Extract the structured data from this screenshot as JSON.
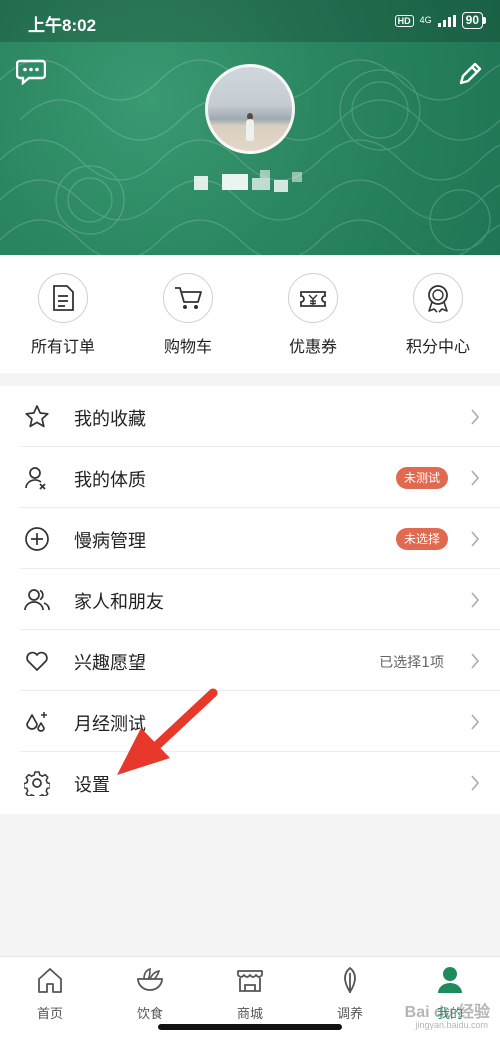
{
  "status": {
    "time": "上午8:02",
    "hd": "HD",
    "network": "4G",
    "battery": "90"
  },
  "quick_actions": [
    {
      "label": "所有订单",
      "icon": "order-list-icon"
    },
    {
      "label": "购物车",
      "icon": "shopping-cart-icon"
    },
    {
      "label": "优惠券",
      "icon": "coupon-icon"
    },
    {
      "label": "积分中心",
      "icon": "award-badge-icon"
    }
  ],
  "menu": [
    {
      "label": "我的收藏",
      "icon": "star-icon"
    },
    {
      "label": "我的体质",
      "icon": "person-check-icon",
      "badge": "未测试"
    },
    {
      "label": "慢病管理",
      "icon": "plus-circle-icon",
      "badge": "未选择"
    },
    {
      "label": "家人和朋友",
      "icon": "people-icon"
    },
    {
      "label": "兴趣愿望",
      "icon": "heart-icon",
      "value": "已选择1项"
    },
    {
      "label": "月经测试",
      "icon": "drops-icon"
    },
    {
      "label": "设置",
      "icon": "gear-icon"
    }
  ],
  "tabs": [
    {
      "label": "首页",
      "icon": "home-icon"
    },
    {
      "label": "饮食",
      "icon": "bowl-icon"
    },
    {
      "label": "商城",
      "icon": "shop-icon"
    },
    {
      "label": "调养",
      "icon": "leaf-icon"
    },
    {
      "label": "我的",
      "icon": "user-icon",
      "active": true
    }
  ],
  "watermark": {
    "text": "Bai du 经验",
    "sub": "jingyan.baidu.com"
  },
  "colors": {
    "header_green": "#2a8660",
    "accent_green": "#1f8a5b",
    "badge_red": "#e0694f",
    "arrow_red": "#e8372b"
  }
}
